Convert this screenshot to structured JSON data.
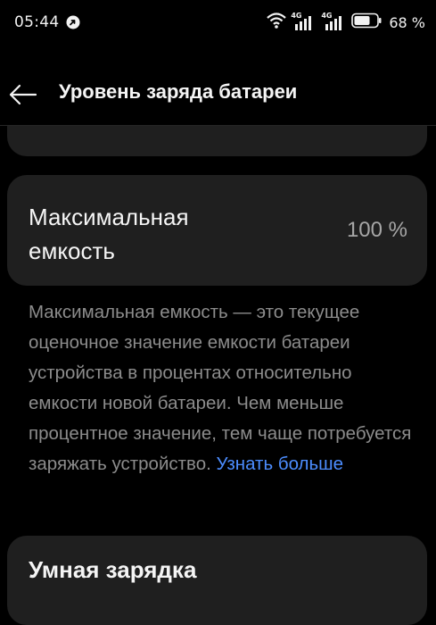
{
  "status_bar": {
    "time": "05:44",
    "network_1": "4G",
    "network_2": "4G",
    "battery_percent": "68 %"
  },
  "header": {
    "title": "Уровень заряда батареи"
  },
  "capacity_card": {
    "label_line1": "Максимальная",
    "label_line2": "емкость",
    "value": "100 %"
  },
  "description": {
    "text": "Максимальная емкость — это текущее оценочное значение емкости батареи устройства в процентах относительно емкости новой батареи. Чем меньше процентное значение, тем чаще потребуется заряжать устройство. ",
    "link": "Узнать больше"
  },
  "smart_charging_card": {
    "label": "Умная зарядка"
  },
  "colors": {
    "background": "#000000",
    "card": "#1f1f1f",
    "link": "#4c8dff",
    "secondary_text": "#8c8c8c"
  }
}
